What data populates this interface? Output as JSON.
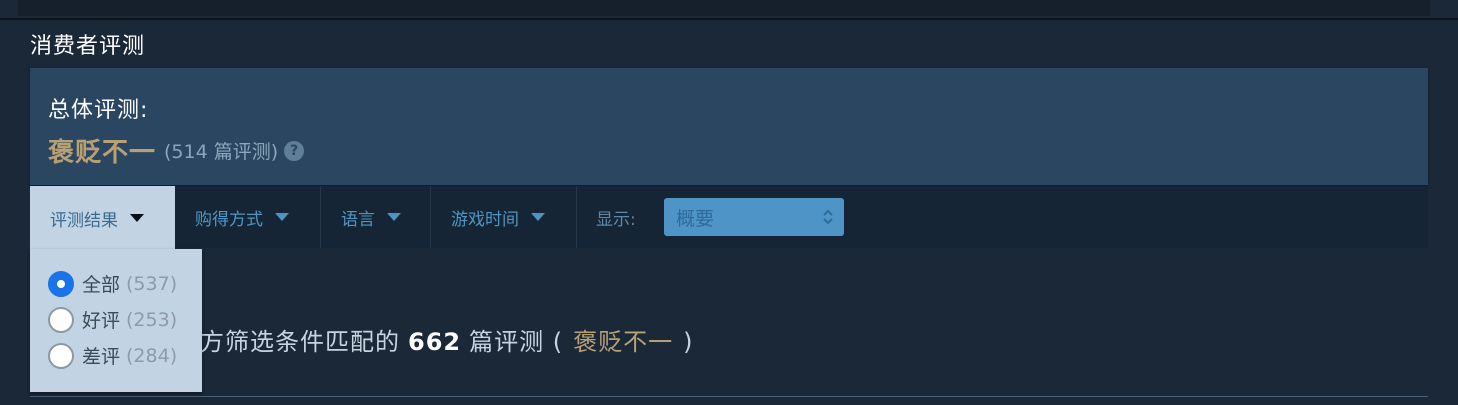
{
  "section_title": "消费者评测",
  "summary": {
    "label": "总体评测:",
    "rating": "褒贬不一",
    "count": "(514 篇评测)",
    "help_glyph": "?",
    "rating_color": "#b9a074"
  },
  "filters": {
    "tabs": [
      {
        "label": "评测结果",
        "active": true
      },
      {
        "label": "购得方式",
        "active": false
      },
      {
        "label": "语言",
        "active": false
      },
      {
        "label": "游戏时间",
        "active": false
      }
    ],
    "display_label": "显示:",
    "display_value": "概要"
  },
  "review_type_options": [
    {
      "label": "全部",
      "count": "(537)",
      "selected": true
    },
    {
      "label": "好评",
      "count": "(253)",
      "selected": false
    },
    {
      "label": "差评",
      "count": "(284)",
      "selected": false
    }
  ],
  "results": {
    "prefix": "方筛选条件匹配的",
    "count": "662",
    "suffix": "篇评测 (",
    "rating": "褒贬不一",
    "close": ")"
  },
  "icons": {
    "help": "help-icon",
    "dropdown": "caret-down-icon",
    "select": "select-arrows-icon"
  }
}
